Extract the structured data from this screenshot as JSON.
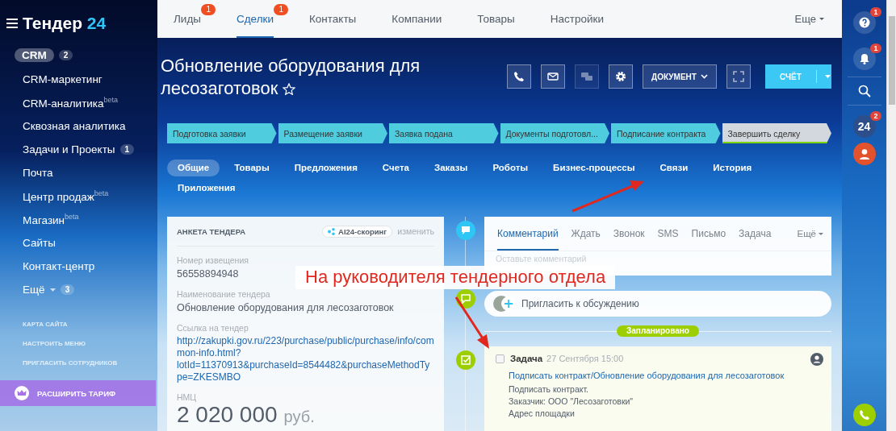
{
  "sidebar": {
    "logo": {
      "name": "Тендер",
      "number": "24"
    },
    "items": [
      {
        "label": "CRM",
        "counter": "2",
        "kind": "link",
        "selected": true
      },
      {
        "label": "CRM-маркетинг",
        "kind": "link",
        "selected": false
      },
      {
        "label": "CRM-аналитика$^{beta}$",
        "kind": "link",
        "selected": false
      },
      {
        "label": "Сквозная аналитика",
        "kind": "link",
        "selected": false
      },
      {
        "label": "Задачи и Проекты",
        "counter": "1",
        "kind": "link",
        "selected": false
      },
      {
        "label": "Почта",
        "kind": "link",
        "selected": false
      },
      {
        "label": "Центр продаж$^{beta}$",
        "kind": "link",
        "selected": false
      },
      {
        "label": "Магазин$^{beta}$",
        "kind": "link",
        "selected": false
      },
      {
        "label": "Сайты",
        "kind": "link",
        "selected": false
      },
      {
        "label": "Контакт-центр",
        "kind": "link",
        "selected": false
      },
      {
        "label": "Ещё",
        "counter": "3",
        "kind": "more",
        "selected": false
      }
    ],
    "links": [
      "КАРТА САЙТА",
      "НАСТРОИТЬ МЕНЮ",
      "ПРИГЛАСИТЬ СОТРУДНИКОВ"
    ],
    "upgrade_button": "РАСШИРИТЬ ТАРИФ"
  },
  "top_nav": {
    "tabs": [
      {
        "label": "Лиды",
        "counter": "1",
        "selected": false
      },
      {
        "label": "Сделки",
        "counter": "1",
        "selected": true
      },
      {
        "label": "Контакты",
        "selected": false
      },
      {
        "label": "Компании",
        "selected": false
      },
      {
        "label": "Товары",
        "selected": false
      },
      {
        "label": "Настройки",
        "selected": false
      }
    ],
    "more": "Еще"
  },
  "deal": {
    "title": "Обновление оборудования для лесозаготовок",
    "starred": false,
    "toolbar": {
      "chat_disabled": true,
      "document_button": "ДОКУМЕНТ",
      "invoice_button": "СЧЁТ"
    },
    "stages": [
      {
        "label": "Подготовка заявки",
        "reached": true
      },
      {
        "label": "Размещение заявки",
        "reached": true
      },
      {
        "label": "Заявка подана",
        "reached": true
      },
      {
        "label": "Документы подготовл...",
        "reached": true
      },
      {
        "label": "Подписание контракта",
        "reached": true
      },
      {
        "label": "Завершить сделку",
        "reached": false
      }
    ],
    "tabs": [
      {
        "label": "Общие",
        "selected": true
      },
      {
        "label": "Товары",
        "selected": false
      },
      {
        "label": "Предложения",
        "selected": false
      },
      {
        "label": "Счета",
        "selected": false
      },
      {
        "label": "Заказы",
        "selected": false
      },
      {
        "label": "Роботы",
        "selected": false
      },
      {
        "label": "Бизнес-процессы",
        "selected": false
      },
      {
        "label": "Связи",
        "selected": false
      },
      {
        "label": "История",
        "selected": false
      },
      {
        "label": "Приложения",
        "selected": false
      }
    ]
  },
  "tender_form": {
    "title": "АНКЕТА ТЕНДЕРА",
    "scoring_button": "AI24-скоринг",
    "edit_link": "изменить",
    "fields": [
      {
        "label": "Номер извещения",
        "value": "56558894948",
        "kind": "text"
      },
      {
        "label": "Наименование тендера",
        "value": "Обновление оборудования для лесозаготовок",
        "kind": "text"
      },
      {
        "label": "Ссылка на тендер",
        "value": "http://zakupki.gov.ru/223/purchase/public/purchase/info/common-info.html?lotId=11370913&purchaseId=8544482&purchaseMethodType=ZKESMBO",
        "kind": "link"
      },
      {
        "label": "НМЦ",
        "value": "2 020 000",
        "currency": "руб.",
        "kind": "money"
      }
    ]
  },
  "activity": {
    "tabs": [
      {
        "label": "Комментарий",
        "selected": true
      },
      {
        "label": "Ждать",
        "selected": false
      },
      {
        "label": "Звонок",
        "selected": false
      },
      {
        "label": "SMS",
        "selected": false
      },
      {
        "label": "Письмо",
        "selected": false
      },
      {
        "label": "Задача",
        "selected": false
      }
    ],
    "more": "Ещё",
    "comment": {
      "placeholder": "Оставьте комментарий"
    },
    "invite": {
      "placeholder": "Пригласить к обсуждению"
    },
    "section_label": "Запланировано",
    "task": {
      "checked": false,
      "type": "Задача",
      "date": "27 Сентября 15:00",
      "title": "Подписать контракт/Обновление оборудования для лесозаготовок",
      "lines": [
        "Подписать контракт.",
        "Заказчик: ООО \"Лесозаготовки\"",
        "Адрес площадки"
      ]
    }
  },
  "right_rail": {
    "help_counter": "1",
    "notifications_counter": "1",
    "app_label": "24",
    "app_counter": "2"
  },
  "annotation": {
    "text": "На руководителя тендерного отдела"
  }
}
